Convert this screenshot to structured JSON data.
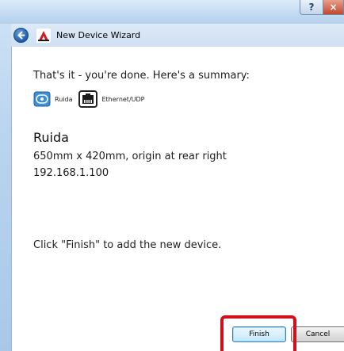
{
  "window": {
    "help_glyph": "?",
    "close_glyph": "×",
    "title": "New Device Wizard"
  },
  "summary": {
    "intro": "That's it - you're done.  Here's a summary:",
    "device_type_label": "Ruida",
    "connection_label": "Ethernet/UDP",
    "device_name": "Ruida",
    "dimensions": "650mm x 420mm, origin at rear right",
    "address": "192.168.1.100",
    "finish_hint": "Click \"Finish\" to add the new device."
  },
  "buttons": {
    "finish": "Finish",
    "cancel": "Cancel"
  },
  "icons": {
    "back": "back-arrow-icon",
    "app": "lightburn-app-icon",
    "device": "ruida-controller-icon",
    "connection": "ethernet-port-icon"
  },
  "colors": {
    "highlight": "#d3101a",
    "accent": "#3c7fb1"
  }
}
